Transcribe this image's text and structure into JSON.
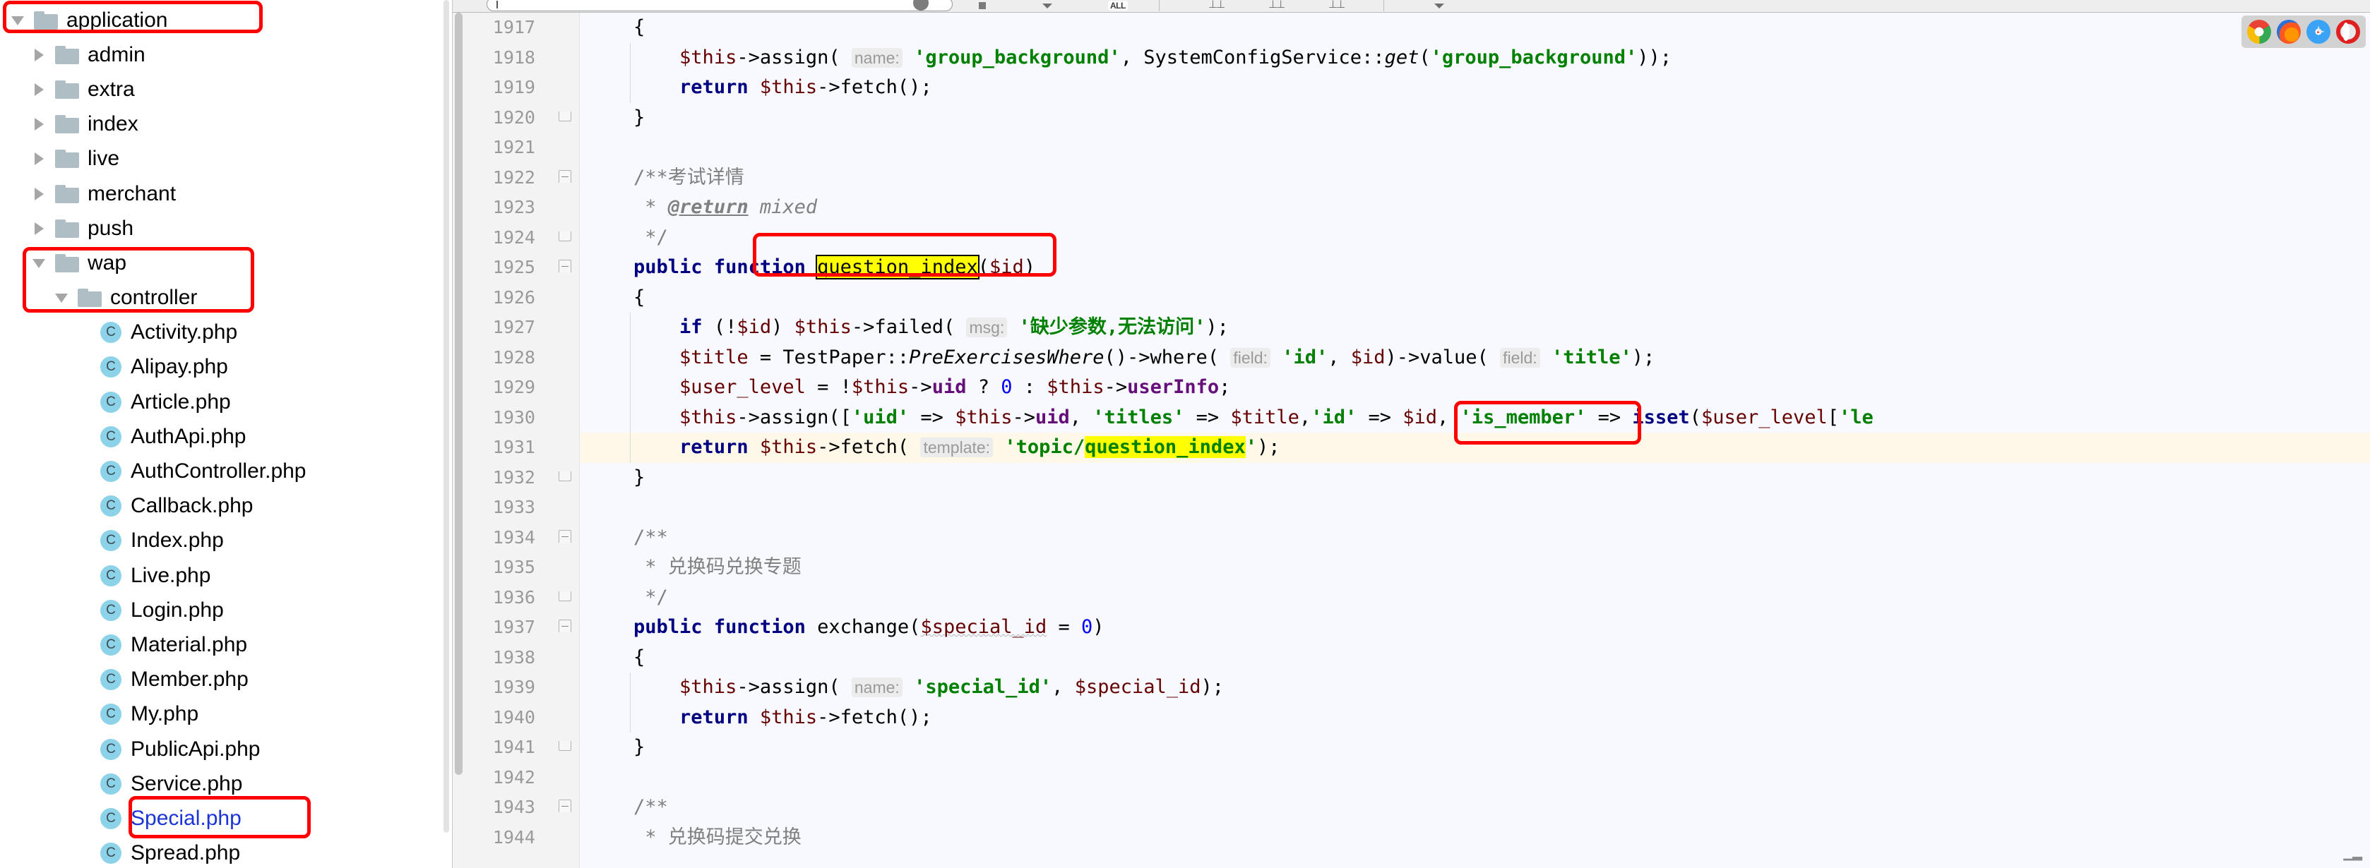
{
  "colors": {
    "annotation": "#ff0000",
    "highlight": "#ffff00",
    "selected_file": "#1b34d6",
    "editor_bg": "#f7f9fe",
    "gutter_bg": "#f3f3f3",
    "caret_line": "#fdf8e8",
    "folder": "#afbdc4",
    "class_icon": "#8cd3ea"
  },
  "find_toolbar": {
    "match_scope_label": "ALL",
    "search_value": "",
    "search_placeholder": ""
  },
  "project_tree": {
    "items": [
      {
        "label": "application",
        "type": "folder",
        "depth": 0,
        "arrow": "expanded",
        "annotated": true
      },
      {
        "label": "admin",
        "type": "folder",
        "depth": 1,
        "arrow": "collapsed",
        "annotated": false
      },
      {
        "label": "extra",
        "type": "folder",
        "depth": 1,
        "arrow": "collapsed",
        "annotated": false
      },
      {
        "label": "index",
        "type": "folder",
        "depth": 1,
        "arrow": "collapsed",
        "annotated": false
      },
      {
        "label": "live",
        "type": "folder",
        "depth": 1,
        "arrow": "collapsed",
        "annotated": false
      },
      {
        "label": "merchant",
        "type": "folder",
        "depth": 1,
        "arrow": "collapsed",
        "annotated": false
      },
      {
        "label": "push",
        "type": "folder",
        "depth": 1,
        "arrow": "collapsed",
        "annotated": false
      },
      {
        "label": "wap",
        "type": "folder",
        "depth": 1,
        "arrow": "expanded",
        "annotated": true
      },
      {
        "label": "controller",
        "type": "folder",
        "depth": 2,
        "arrow": "expanded",
        "annotated": true
      },
      {
        "label": "Activity.php",
        "type": "class",
        "depth": 3,
        "arrow": "none",
        "annotated": false
      },
      {
        "label": "Alipay.php",
        "type": "class",
        "depth": 3,
        "arrow": "none",
        "annotated": false
      },
      {
        "label": "Article.php",
        "type": "class",
        "depth": 3,
        "arrow": "none",
        "annotated": false
      },
      {
        "label": "AuthApi.php",
        "type": "class",
        "depth": 3,
        "arrow": "none",
        "annotated": false
      },
      {
        "label": "AuthController.php",
        "type": "class",
        "depth": 3,
        "arrow": "none",
        "annotated": false
      },
      {
        "label": "Callback.php",
        "type": "class",
        "depth": 3,
        "arrow": "none",
        "annotated": false
      },
      {
        "label": "Index.php",
        "type": "class",
        "depth": 3,
        "arrow": "none",
        "annotated": false
      },
      {
        "label": "Live.php",
        "type": "class",
        "depth": 3,
        "arrow": "none",
        "annotated": false
      },
      {
        "label": "Login.php",
        "type": "class",
        "depth": 3,
        "arrow": "none",
        "annotated": false
      },
      {
        "label": "Material.php",
        "type": "class",
        "depth": 3,
        "arrow": "none",
        "annotated": false
      },
      {
        "label": "Member.php",
        "type": "class",
        "depth": 3,
        "arrow": "none",
        "annotated": false
      },
      {
        "label": "My.php",
        "type": "class",
        "depth": 3,
        "arrow": "none",
        "annotated": false
      },
      {
        "label": "PublicApi.php",
        "type": "class",
        "depth": 3,
        "arrow": "none",
        "annotated": false
      },
      {
        "label": "Service.php",
        "type": "class",
        "depth": 3,
        "arrow": "none",
        "annotated": false
      },
      {
        "label": "Special.php",
        "type": "class",
        "depth": 3,
        "arrow": "none",
        "annotated": true,
        "selected": true
      },
      {
        "label": "Spread.php",
        "type": "class",
        "depth": 3,
        "arrow": "none",
        "annotated": false
      }
    ]
  },
  "editor": {
    "first_line_number": 1917,
    "caret_line_number": 1931,
    "lines": [
      {
        "n": 1917,
        "text": "    {"
      },
      {
        "n": 1918,
        "text": "        $this->assign( name: 'group_background', SystemConfigService::get('group_background'));"
      },
      {
        "n": 1919,
        "text": "        return $this->fetch();"
      },
      {
        "n": 1920,
        "text": "    }"
      },
      {
        "n": 1921,
        "text": ""
      },
      {
        "n": 1922,
        "text": "    /**考试详情"
      },
      {
        "n": 1923,
        "text": "     * @return mixed"
      },
      {
        "n": 1924,
        "text": "     */"
      },
      {
        "n": 1925,
        "text": "    public function question_index($id)"
      },
      {
        "n": 1926,
        "text": "    {"
      },
      {
        "n": 1927,
        "text": "        if (!$id) $this->failed( msg: '缺少参数,无法访问');"
      },
      {
        "n": 1928,
        "text": "        $title = TestPaper::PreExercisesWhere()->where( field: 'id', $id)->value( field: 'title');"
      },
      {
        "n": 1929,
        "text": "        $user_level = !$this->uid ? 0 : $this->userInfo;"
      },
      {
        "n": 1930,
        "text": "        $this->assign(['uid' => $this->uid, 'titles' => $title, 'id' => $id, 'is_member' => isset($user_level['le"
      },
      {
        "n": 1931,
        "text": "        return $this->fetch( template: 'topic/question_index');"
      },
      {
        "n": 1932,
        "text": "    }"
      },
      {
        "n": 1933,
        "text": ""
      },
      {
        "n": 1934,
        "text": "    /**"
      },
      {
        "n": 1935,
        "text": "     * 兑换码兑换专题"
      },
      {
        "n": 1936,
        "text": "     */"
      },
      {
        "n": 1937,
        "text": "    public function exchange($special_id = 0)"
      },
      {
        "n": 1938,
        "text": "    {"
      },
      {
        "n": 1939,
        "text": "        $this->assign( name: 'special_id', $special_id);"
      },
      {
        "n": 1940,
        "text": "        return $this->fetch();"
      },
      {
        "n": 1941,
        "text": "    }"
      },
      {
        "n": 1942,
        "text": ""
      },
      {
        "n": 1943,
        "text": "    /**"
      },
      {
        "n": 1944,
        "text": "     * 兑换码提交兑换"
      }
    ],
    "highlighted_tokens": [
      "question_index",
      "topic/question_index"
    ],
    "annotations": [
      {
        "target": "function-name",
        "label": "question_index"
      },
      {
        "target": "array-entry",
        "label": "'id' => $id,"
      }
    ]
  },
  "run_targets": {
    "items": [
      {
        "name": "chrome-icon",
        "label": "Chrome"
      },
      {
        "name": "firefox-icon",
        "label": "Firefox"
      },
      {
        "name": "safari-icon",
        "label": "Safari"
      },
      {
        "name": "opera-icon",
        "label": "Opera"
      }
    ]
  }
}
